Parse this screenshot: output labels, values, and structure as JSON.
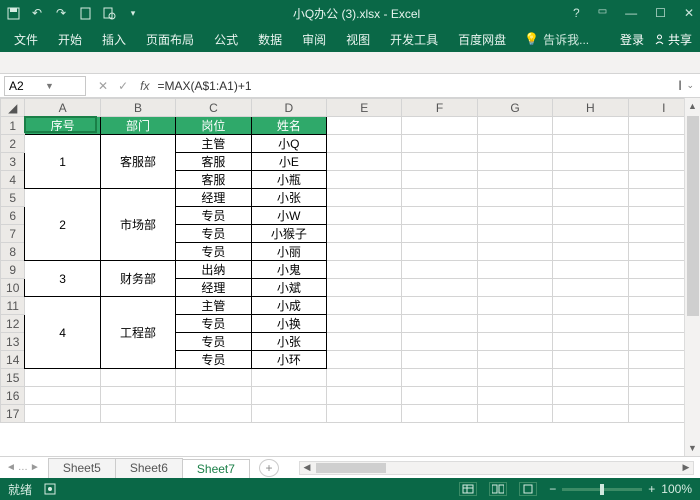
{
  "title": "小Q办公 (3).xlsx - Excel",
  "ribbon": {
    "tabs": [
      "文件",
      "开始",
      "插入",
      "页面布局",
      "公式",
      "数据",
      "审阅",
      "视图",
      "开发工具",
      "百度网盘"
    ],
    "tell": "告诉我...",
    "login": "登录",
    "share": "共享"
  },
  "formula": {
    "cell": "A2",
    "value": "=MAX(A$1:A1)+1"
  },
  "cols": [
    "A",
    "B",
    "C",
    "D",
    "E",
    "F",
    "G",
    "H",
    "I"
  ],
  "rows": 17,
  "header": [
    "序号",
    "部门",
    "岗位",
    "姓名"
  ],
  "blocks": [
    {
      "num": "1",
      "dept": "客服部",
      "rows": [
        [
          "主管",
          "小Q"
        ],
        [
          "客服",
          "小E"
        ],
        [
          "客服",
          "小瓶"
        ]
      ]
    },
    {
      "num": "2",
      "dept": "市场部",
      "rows": [
        [
          "经理",
          "小张"
        ],
        [
          "专员",
          "小W"
        ],
        [
          "专员",
          "小猴子"
        ],
        [
          "专员",
          "小丽"
        ]
      ]
    },
    {
      "num": "3",
      "dept": "财务部",
      "rows": [
        [
          "出纳",
          "小鬼"
        ],
        [
          "经理",
          "小斌"
        ]
      ]
    },
    {
      "num": "4",
      "dept": "工程部",
      "rows": [
        [
          "主管",
          "小成"
        ],
        [
          "专员",
          "小换"
        ],
        [
          "专员",
          "小张"
        ],
        [
          "专员",
          "小环"
        ]
      ]
    }
  ],
  "sheets": [
    "Sheet5",
    "Sheet6",
    "Sheet7"
  ],
  "activeSheet": 2,
  "status": {
    "ready": "就绪",
    "zoom": "100%"
  }
}
